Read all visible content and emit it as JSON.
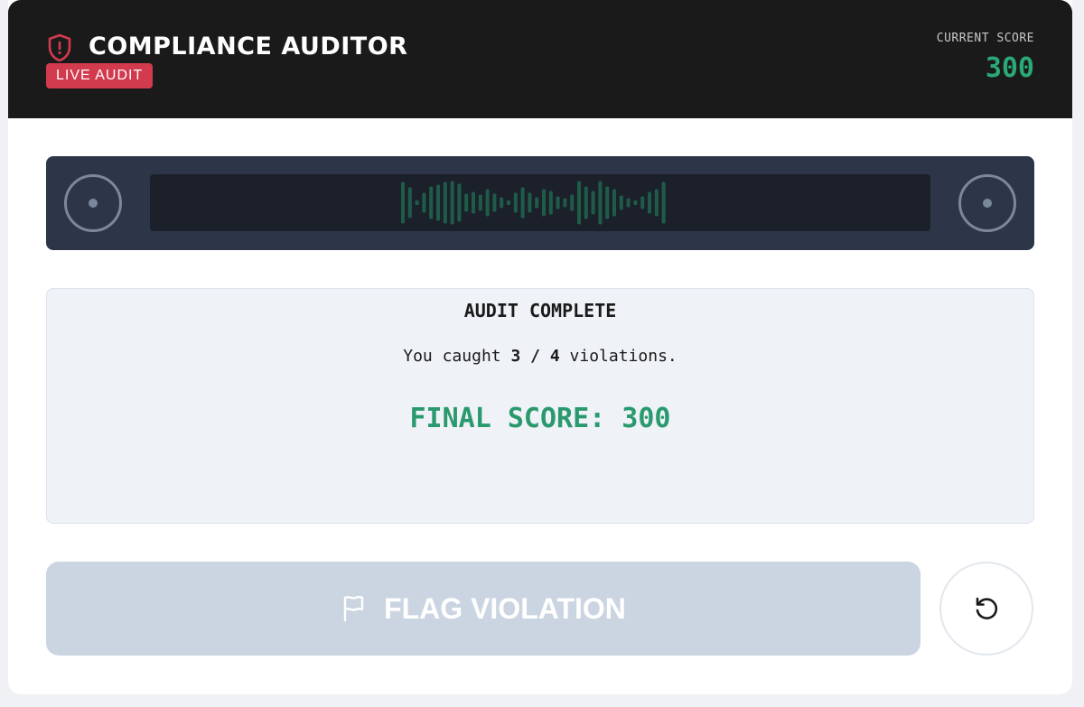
{
  "header": {
    "title": "COMPLIANCE AUDITOR",
    "badge": "LIVE AUDIT",
    "score_label": "CURRENT SCORE",
    "score_value": "300",
    "badge_color": "#d23a4e",
    "accent_color": "#2aa876"
  },
  "tape": {
    "left_reel_icon": "reel-icon",
    "right_reel_icon": "reel-icon",
    "waveform_color": "#1f5c48"
  },
  "result": {
    "title": "AUDIT COMPLETE",
    "line_prefix": "You caught",
    "caught": "3",
    "separator": "/",
    "total": "4",
    "line_suffix": "violations.",
    "final_score": "FINAL SCORE: 300"
  },
  "actions": {
    "flag_label": "FLAG VIOLATION",
    "flag_icon": "flag-icon",
    "reset_icon": "rotate-ccw-icon"
  }
}
